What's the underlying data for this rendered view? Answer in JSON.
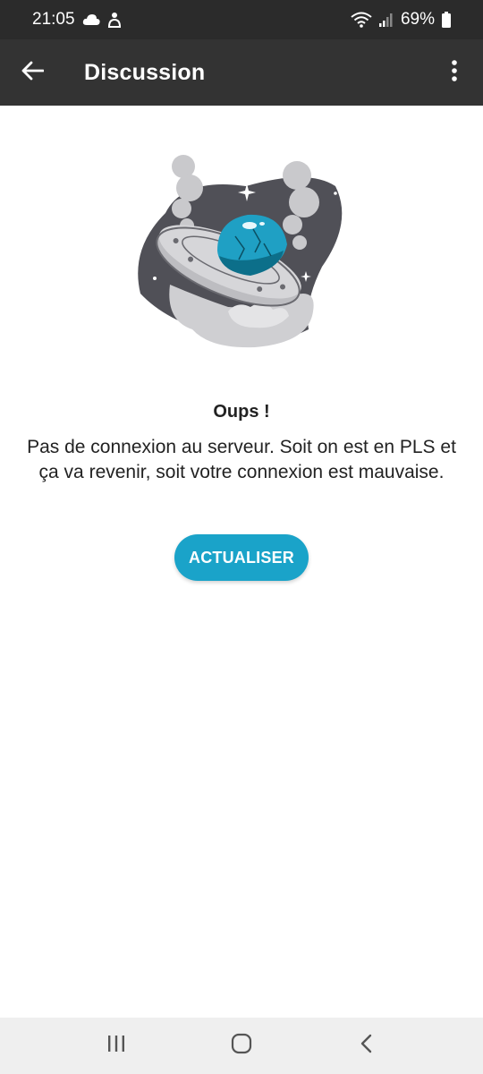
{
  "status_bar": {
    "time": "21:05",
    "battery": "69%",
    "icons": [
      "cloud-icon",
      "notification-person-icon",
      "wifi-icon",
      "signal-icon",
      "battery-icon"
    ]
  },
  "app_bar": {
    "title": "Discussion",
    "back_icon": "arrow-left-icon",
    "menu_icon": "more-vertical-icon"
  },
  "error": {
    "title": "Oups !",
    "message": "Pas de connexion au serveur. Soit on est en PLS et ça va revenir, soit votre connexion est mauvaise.",
    "button_label": "ACTUALISER"
  },
  "nav_bar": {
    "icons": [
      "recent-apps-icon",
      "home-icon",
      "back-icon"
    ]
  },
  "colors": {
    "status_bar": "#2b2b2b",
    "app_bar": "#333333",
    "accent": "#1aa3c9",
    "nav_bar": "#efefef"
  }
}
